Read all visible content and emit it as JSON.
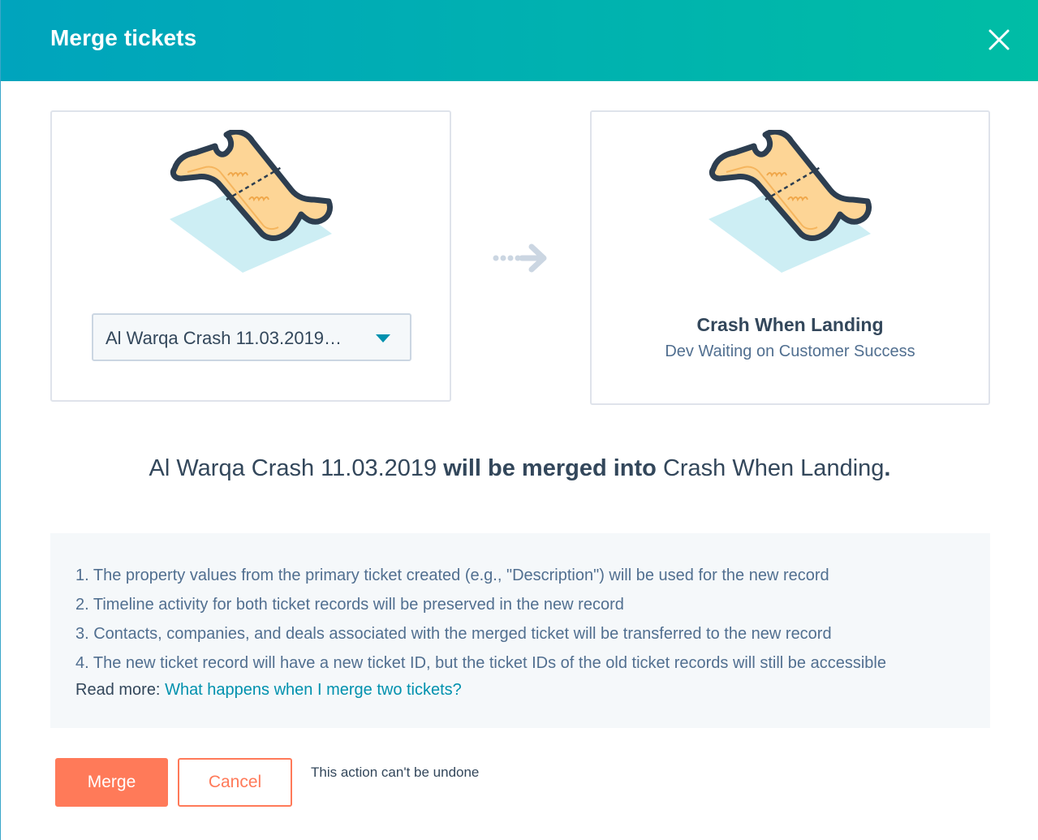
{
  "modal": {
    "title": "Merge tickets",
    "close_icon": "close-icon",
    "header_gradient": [
      "#00a4bd",
      "#00bda5"
    ]
  },
  "source_ticket": {
    "icon": "ticket-icon",
    "select_value": "Al Warqa Crash 11.03.2019…",
    "dropdown_icon": "caret-down-icon"
  },
  "arrow_icon": "dotted-arrow-right-icon",
  "target_ticket": {
    "icon": "ticket-icon",
    "name": "Crash When Landing",
    "status": "Dev Waiting on Customer Success"
  },
  "summary": {
    "source": "Al Warqa Crash 11.03.2019",
    "connector": "will be merged into",
    "target": "Crash When Landing",
    "period": "."
  },
  "info": {
    "items": [
      "1. The property values from the primary ticket created (e.g., \"Description\") will be used for the new record",
      "2. Timeline activity for both ticket records will be preserved in the new record",
      "3. Contacts, companies, and deals associated with the merged ticket will be transferred to the new record",
      "4. The new ticket record will have a new ticket ID, but the ticket IDs of the old ticket records will still be accessible"
    ],
    "read_more_label": "Read more:",
    "read_more_link": "What happens when I merge two tickets?"
  },
  "footer": {
    "merge_label": "Merge",
    "cancel_label": "Cancel",
    "note": "This action can't be undone"
  },
  "colors": {
    "accent_orange": "#ff7a59",
    "link_blue": "#0091ae",
    "text_dark": "#33475b",
    "text_muted": "#516f90"
  }
}
